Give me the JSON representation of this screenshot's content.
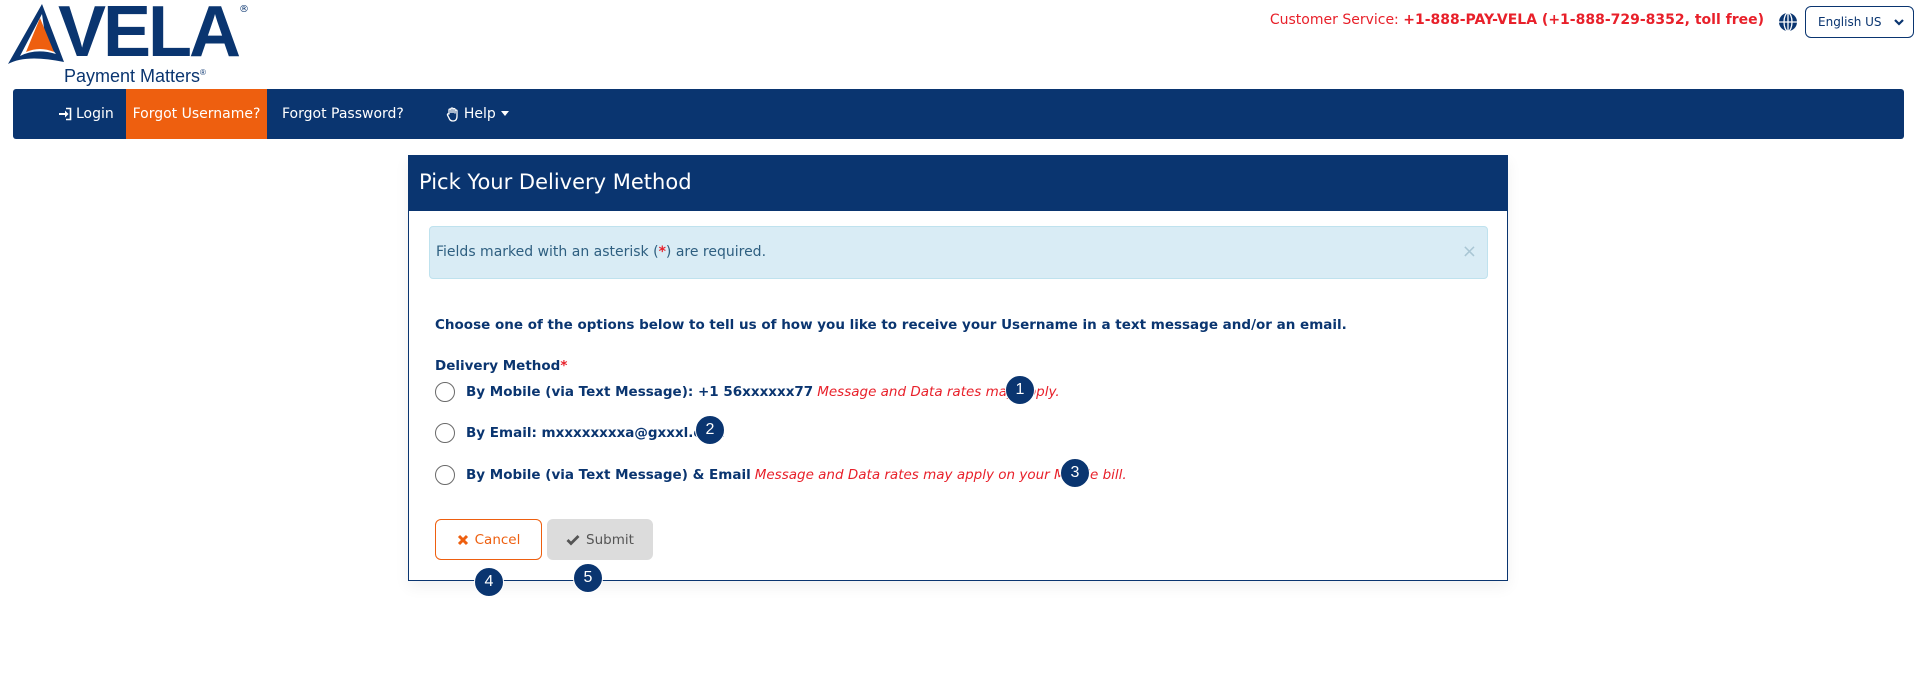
{
  "brand": {
    "name": "VELA",
    "registered_mark": "®",
    "tagline": "Payment Matters",
    "colors": {
      "navy": "#0a3570",
      "orange": "#ee5f0f",
      "red": "#e8202a"
    }
  },
  "header": {
    "customer_service_label": "Customer Service:",
    "customer_service_number": "+1-888-PAY-VELA (+1-888-729-8352, toll free)",
    "language_icon": "globe-icon",
    "language_select": {
      "selected": "English US"
    }
  },
  "nav": {
    "items": [
      {
        "label": "Login",
        "icon": "sign-in-icon",
        "active": false
      },
      {
        "label": "Forgot Username?",
        "active": true
      },
      {
        "label": "Forgot Password?",
        "active": false
      },
      {
        "label": "Help",
        "icon": "hand-icon",
        "dropdown": true,
        "active": false
      }
    ]
  },
  "card": {
    "title": "Pick Your Delivery Method",
    "alert": {
      "text_before": "Fields marked with an asterisk (",
      "asterisk": "*",
      "text_after": ") are required.",
      "close": "×"
    },
    "intro": "Choose one of the options below to tell us of how you like to receive your Username in a text message and/or an email.",
    "delivery_method_label": "Delivery Method",
    "required_mark": "*",
    "options": [
      {
        "label": "By Mobile (via Text Message): +1 56xxxxxx77",
        "note": "Message and Data rates may apply.",
        "selected": false,
        "badge": "1"
      },
      {
        "label": "By Email: mxxxxxxxxa@gxxxl.com",
        "note": "",
        "selected": false,
        "badge": "2"
      },
      {
        "label": "By Mobile (via Text Message) & Email",
        "note": "Message and Data rates may apply on your Mobile bill.",
        "selected": false,
        "badge": "3"
      }
    ],
    "buttons": {
      "cancel": {
        "label": "Cancel",
        "icon": "x-icon",
        "badge": "4"
      },
      "submit": {
        "label": "Submit",
        "icon": "check-icon",
        "badge": "5",
        "disabled": true
      }
    }
  }
}
